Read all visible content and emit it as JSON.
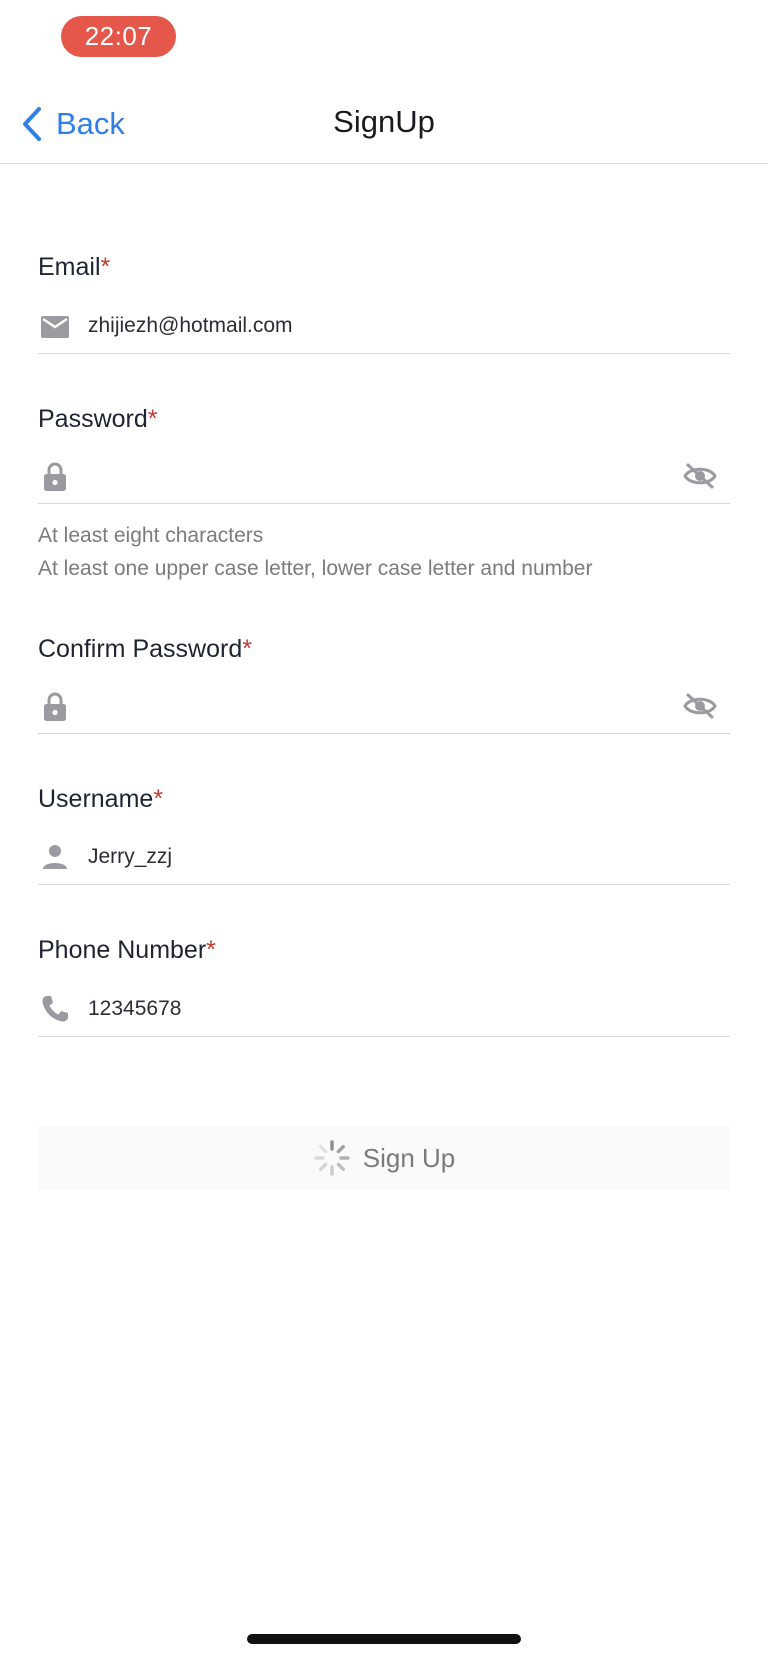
{
  "status_bar": {
    "time": "22:07"
  },
  "nav": {
    "back_label": "Back",
    "title": "SignUp"
  },
  "form": {
    "required_mark": "*",
    "email": {
      "label": "Email",
      "value": "zhijiezh@hotmail.com",
      "icon": "mail-icon"
    },
    "password": {
      "label": "Password",
      "value": "",
      "icon": "lock-icon",
      "toggle_icon": "eye-off-icon",
      "hints": [
        "At least eight characters",
        "At least one upper case letter, lower case letter and number"
      ]
    },
    "confirm_password": {
      "label": "Confirm Password",
      "value": "",
      "icon": "lock-icon",
      "toggle_icon": "eye-off-icon"
    },
    "username": {
      "label": "Username",
      "value": "Jerry_zzj",
      "icon": "person-icon"
    },
    "phone": {
      "label": "Phone Number",
      "value": "12345678",
      "icon": "phone-icon"
    }
  },
  "signup_button": {
    "label": "Sign Up",
    "state": "loading"
  },
  "colors": {
    "accent": "#2f7fe6",
    "time_pill": "#e5574b",
    "required": "#c43a2f",
    "icon_gray": "#9a9aa0"
  }
}
